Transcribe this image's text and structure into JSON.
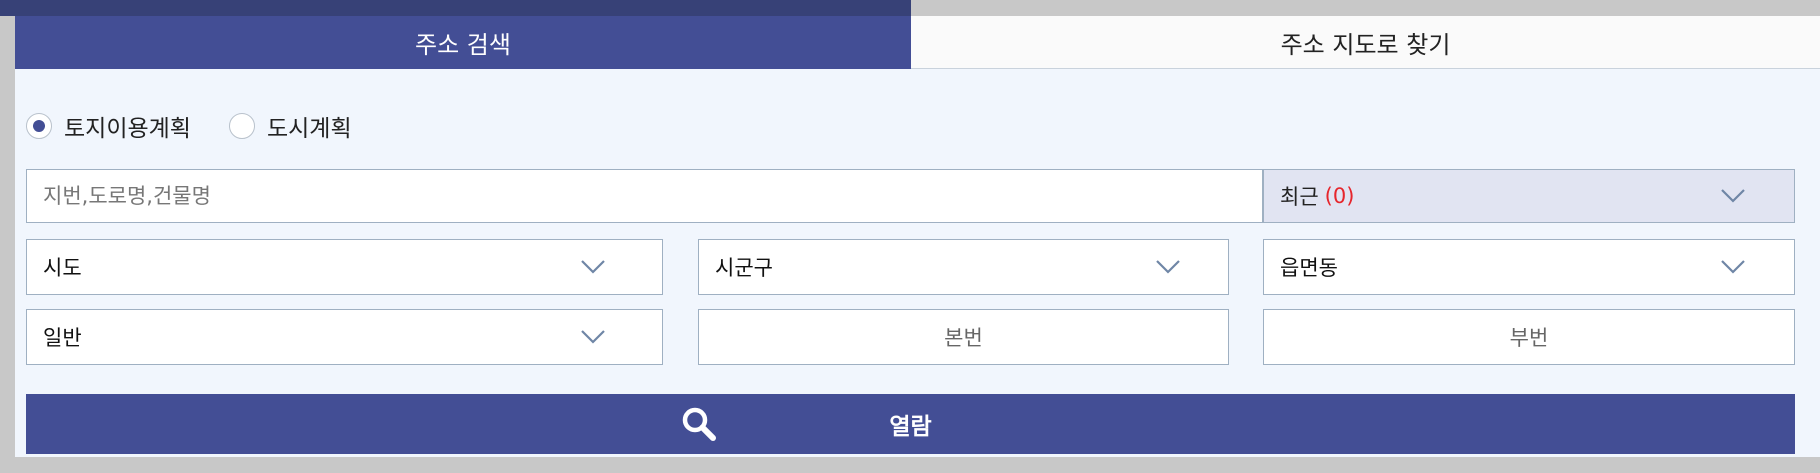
{
  "tabs": [
    {
      "label": "주소 검색",
      "active": true
    },
    {
      "label": "주소 지도로 찾기",
      "active": false
    }
  ],
  "radio_options": [
    {
      "label": "토지이용계획",
      "selected": true
    },
    {
      "label": "도시계획",
      "selected": false
    }
  ],
  "search": {
    "placeholder": "지번,도로명,건물명",
    "value": ""
  },
  "recent": {
    "label": "최근",
    "count": "(0)"
  },
  "selects": {
    "sido": "시도",
    "sigungu": "시군구",
    "eupmyeondong": "읍면동",
    "land_type": "일반"
  },
  "lot_inputs": {
    "main_placeholder": "본번",
    "sub_placeholder": "부번"
  },
  "submit": {
    "label": "열람",
    "icon": "search-icon"
  },
  "colors": {
    "accent": "#434e95",
    "panel_bg": "#f1f6fd",
    "recent_bg": "#e1e4f2",
    "count_red": "#e6262d",
    "chevron": "#6f86a6"
  }
}
